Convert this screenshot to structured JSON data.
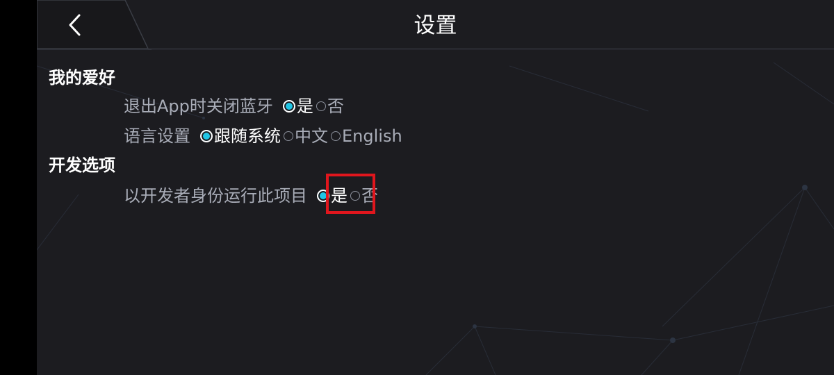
{
  "header": {
    "title": "设置",
    "back_icon": "chevron-left-icon"
  },
  "sections": [
    {
      "title": "我的爱好",
      "rows": [
        {
          "label": "退出App时关闭蓝牙",
          "options": [
            {
              "label": "是",
              "selected": true
            },
            {
              "label": "否",
              "selected": false
            }
          ]
        },
        {
          "label": "语言设置",
          "options": [
            {
              "label": "跟随系统",
              "selected": true
            },
            {
              "label": "中文",
              "selected": false
            },
            {
              "label": "English",
              "selected": false
            }
          ]
        }
      ]
    },
    {
      "title": "开发选项",
      "rows": [
        {
          "label": "以开发者身份运行此项目",
          "options": [
            {
              "label": "是",
              "selected": true
            },
            {
              "label": "否",
              "selected": false
            }
          ]
        }
      ]
    }
  ],
  "colors": {
    "background": "#1c1c20",
    "accent": "#1fc6e6",
    "label_text": "#a9adb8",
    "highlight": "#e0161d"
  }
}
